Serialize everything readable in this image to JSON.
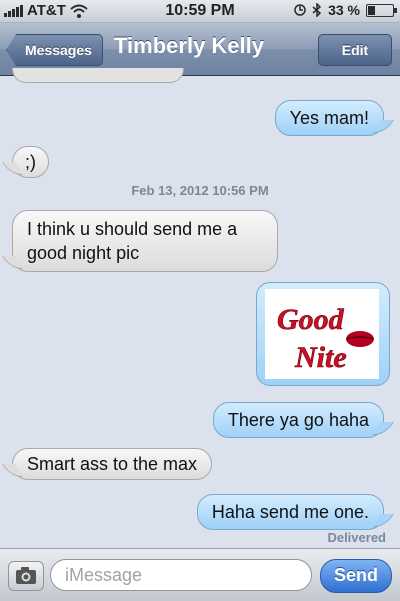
{
  "status": {
    "carrier": "AT&T",
    "time": "10:59 PM",
    "battery": "33 %",
    "battery_level": 0.33
  },
  "nav": {
    "back_label": "Messages",
    "title": "Timberly Kelly",
    "edit_label": "Edit"
  },
  "conversation": {
    "msg1": "Yes mam!",
    "msg2": ";)",
    "timestamp": "Feb 13, 2012 10:56 PM",
    "msg3_line1": "I think u should send me a",
    "msg3_line2": "good night pic",
    "image_text_line1": "Good",
    "image_text_line2": "Nite",
    "msg4": "There ya go haha",
    "msg5": "Smart ass to the max",
    "msg6": "Haha send me one.",
    "delivered": "Delivered"
  },
  "input": {
    "placeholder": "iMessage",
    "send_label": "Send"
  },
  "colors": {
    "nav": "#7d8fab",
    "outgoing": "#9fd1f7",
    "incoming": "#dcdcdc",
    "send": "#2f6fd0"
  }
}
